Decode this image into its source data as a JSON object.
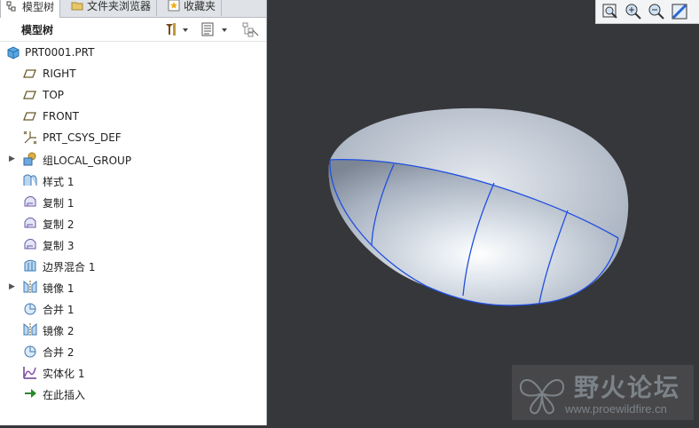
{
  "tabs": [
    {
      "label": "模型树",
      "icon": "model-tree-icon",
      "active": true
    },
    {
      "label": "文件夹浏览器",
      "icon": "folder-browser-icon",
      "active": false
    },
    {
      "label": "收藏夹",
      "icon": "favorites-icon",
      "active": false
    }
  ],
  "header": {
    "title": "模型树"
  },
  "tree": [
    {
      "label": "PRT0001.PRT",
      "icon": "part-icon",
      "expandable": false
    },
    {
      "label": "RIGHT",
      "icon": "datum-plane-icon",
      "expandable": false
    },
    {
      "label": "TOP",
      "icon": "datum-plane-icon",
      "expandable": false
    },
    {
      "label": "FRONT",
      "icon": "datum-plane-icon",
      "expandable": false
    },
    {
      "label": "PRT_CSYS_DEF",
      "icon": "coordinate-system-icon",
      "expandable": false
    },
    {
      "label": "组LOCAL_GROUP",
      "icon": "group-icon",
      "expandable": true
    },
    {
      "label": "样式 1",
      "icon": "style-icon",
      "expandable": false
    },
    {
      "label": "复制 1",
      "icon": "copy-icon",
      "expandable": false
    },
    {
      "label": "复制 2",
      "icon": "copy-icon",
      "expandable": false
    },
    {
      "label": "复制 3",
      "icon": "copy-icon",
      "expandable": false
    },
    {
      "label": "边界混合 1",
      "icon": "boundary-blend-icon",
      "expandable": false
    },
    {
      "label": "镜像 1",
      "icon": "mirror-icon",
      "expandable": true
    },
    {
      "label": "合并 1",
      "icon": "merge-icon",
      "expandable": false
    },
    {
      "label": "镜像 2",
      "icon": "mirror-icon",
      "expandable": false
    },
    {
      "label": "合并 2",
      "icon": "merge-icon",
      "expandable": false
    },
    {
      "label": "实体化 1",
      "icon": "solidify-icon",
      "expandable": false
    },
    {
      "label": "在此插入",
      "icon": "insert-here-arrow-icon",
      "expandable": false
    }
  ],
  "watermark": {
    "name": "野火论坛",
    "url": "www.proewildfire.cn"
  },
  "colors": {
    "viewport_bg": "#36373a",
    "model_surface": "#c2cad6",
    "edge_blue": "#1f4fe0",
    "accent": "#2a6ad0"
  }
}
